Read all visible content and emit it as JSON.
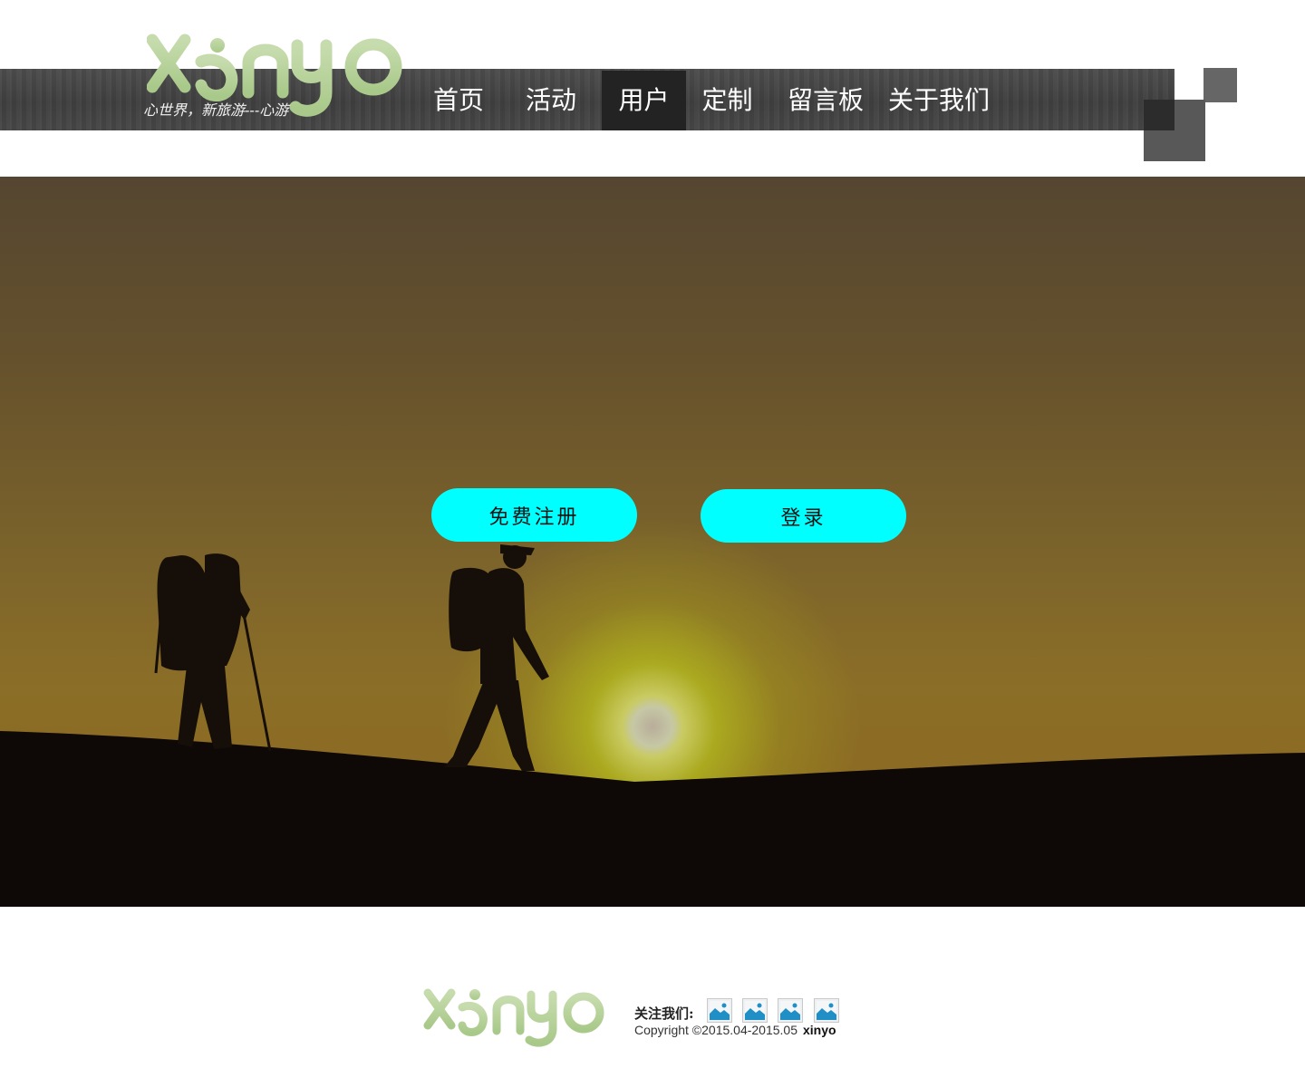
{
  "header": {
    "logo_text": "xinyo",
    "slogan": "心世界，新旅游---心游",
    "nav": [
      {
        "label": "首页",
        "active": false
      },
      {
        "label": "活动",
        "active": false
      },
      {
        "label": "用户",
        "active": true
      },
      {
        "label": "定制",
        "active": false
      },
      {
        "label": "留言板",
        "active": false
      },
      {
        "label": "关于我们",
        "active": false
      }
    ]
  },
  "hero": {
    "register_button": "免费注册",
    "login_button": "登录"
  },
  "footer": {
    "logo_text": "xinyo",
    "follow_label": "关注我们:",
    "social_icons": [
      "image-icon",
      "image-icon",
      "image-icon",
      "image-icon"
    ],
    "copyright": "Copyright  ©2015.04-2015.05",
    "brand": "xinyo"
  },
  "colors": {
    "nav_bg": "#444444",
    "nav_active": "#232323",
    "logo_green": "#b7d19a",
    "button_bg": "#00ffff"
  }
}
